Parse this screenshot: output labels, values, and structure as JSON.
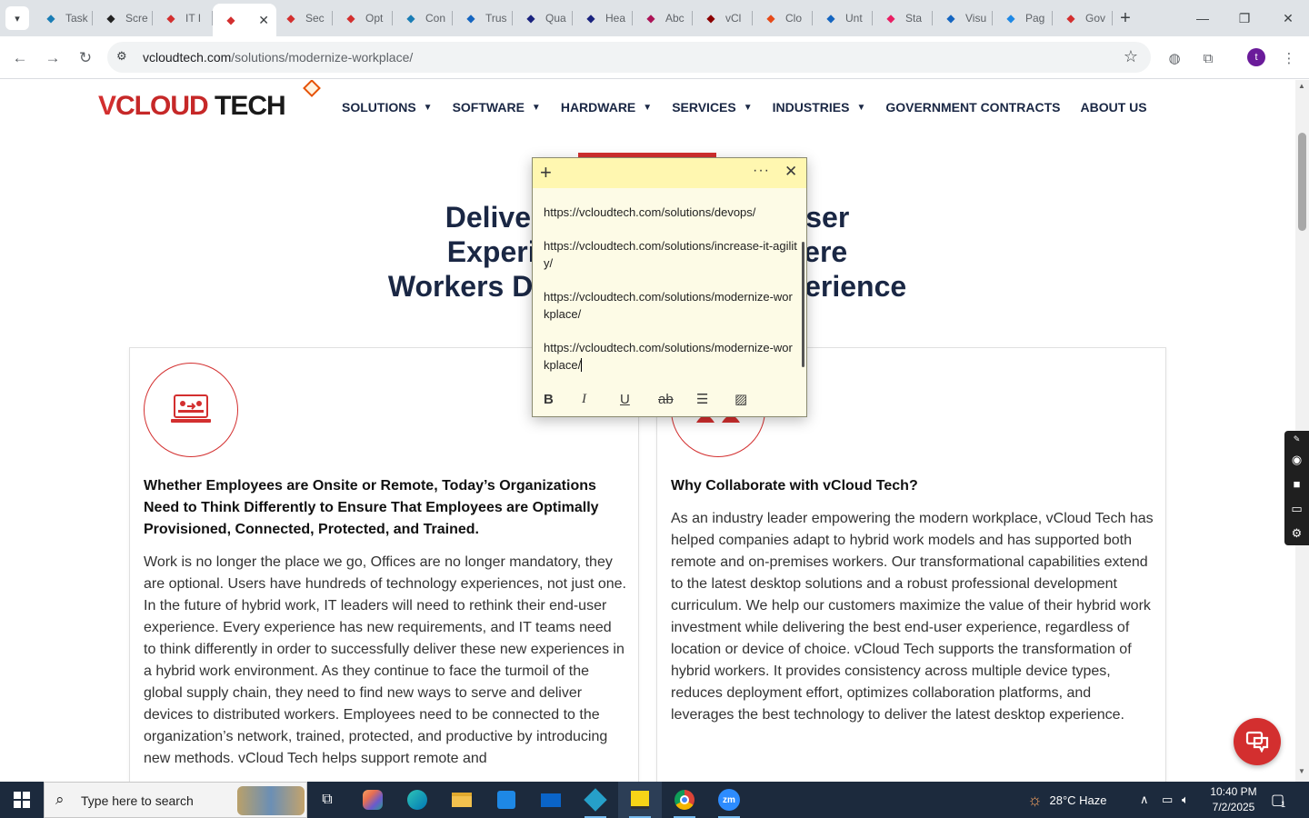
{
  "browser": {
    "tabs": [
      {
        "label": "Task",
        "favicon": "blue-diamond-icon",
        "color": "#1a7db5"
      },
      {
        "label": "Scre",
        "favicon": "gear-icon",
        "color": "#222222"
      },
      {
        "label": "IT I",
        "favicon": "tag-icon",
        "color": "#d32f2f"
      },
      {
        "label": "",
        "favicon": "tag-icon",
        "color": "#d32f2f",
        "active": true
      },
      {
        "label": "Sec",
        "favicon": "tag-icon",
        "color": "#d32f2f"
      },
      {
        "label": "Opt",
        "favicon": "tag-icon",
        "color": "#d32f2f"
      },
      {
        "label": "Con",
        "favicon": "blue-diamond-icon",
        "color": "#1a7db5"
      },
      {
        "label": "Trus",
        "favicon": "scales-icon",
        "color": "#1565c0"
      },
      {
        "label": "Qua",
        "favicon": "x-icon",
        "color": "#1a237e"
      },
      {
        "label": "Hea",
        "favicon": "check-icon",
        "color": "#1a237e"
      },
      {
        "label": "Abc",
        "favicon": "swirl-icon",
        "color": "#ad1457"
      },
      {
        "label": "vCl",
        "favicon": "v-icon",
        "color": "#8b0000"
      },
      {
        "label": "Clo",
        "favicon": "slash-icon",
        "color": "#e64a19"
      },
      {
        "label": "Unt",
        "favicon": "doc-icon",
        "color": "#1565c0"
      },
      {
        "label": "Sta",
        "favicon": "pin-icon",
        "color": "#e91e63"
      },
      {
        "label": "Visu",
        "favicon": "pulse-icon",
        "color": "#1565c0"
      },
      {
        "label": "Pag",
        "favicon": "gauge-icon",
        "color": "#1e88e5"
      },
      {
        "label": "Gov",
        "favicon": "tag-icon",
        "color": "#d32f2f"
      }
    ],
    "new_tab": "+",
    "address": {
      "domain": "vcloudtech.com",
      "path": "/solutions/modernize-workplace/"
    },
    "profile_initial": "t"
  },
  "site": {
    "logo": {
      "v": "V",
      "cloud": "CLOUD",
      "tech": " TECH"
    },
    "nav": [
      {
        "label": "SOLUTIONS",
        "dropdown": true
      },
      {
        "label": "SOFTWARE",
        "dropdown": true
      },
      {
        "label": "HARDWARE",
        "dropdown": true
      },
      {
        "label": "SERVICES",
        "dropdown": true
      },
      {
        "label": "INDUSTRIES",
        "dropdown": true
      },
      {
        "label": "GOVERNMENT CONTRACTS",
        "dropdown": false
      },
      {
        "label": "ABOUT US",
        "dropdown": false
      }
    ],
    "hero_lines": [
      "Delivering an Optimized User",
      "Experience in a World Where",
      "Workers Demand a Better Experience"
    ],
    "left_card": {
      "heading": "Whether Employees are Onsite or Remote, Today’s Organizations Need to Think Differently to Ensure That Employees are Optimally Provisioned, Connected, Protected, and Trained.",
      "body": "Work is no longer the place we go, Offices are no longer mandatory, they are optional. Users have hundreds of technology experiences, not just one.  In the future of hybrid work, IT leaders will need to rethink their end-user experience. Every experience has new requirements, and IT teams need to think differently in order to successfully deliver these new experiences in a hybrid work environment. As they continue to face the turmoil of the global supply chain, they need to find new ways to serve and deliver devices to distributed workers. Employees need to be connected to the organization’s network, trained, protected, and productive by introducing new methods. vCloud Tech helps support remote and"
    },
    "right_card": {
      "heading": "Why Collaborate with vCloud Tech?",
      "body": "As an industry leader empowering the modern workplace, vCloud Tech has helped companies adapt to hybrid work models and has supported both remote and on-premises workers. Our transformational capabilities extend to the latest desktop solutions and a robust professional development curriculum. We help our customers maximize the value of their hybrid work investment while delivering the best end-user experience, regardless of location or device of choice. vCloud Tech supports the transformation of hybrid workers. It provides consistency across multiple device types, reduces deployment effort, optimizes collaboration platforms, and leverages the best technology to deliver the latest desktop experience."
    }
  },
  "sticky_note": {
    "lines": [
      "https://vcloudtech.com/solutions/devops/",
      "https://vcloudtech.com/solutions/increase-it-agility/",
      "https://vcloudtech.com/solutions/modernize-workplace/",
      "https://vcloudtech.com/solutions/modernize-workplace/"
    ],
    "toolbar": [
      "B",
      "I",
      "U",
      "ab",
      "list",
      "image"
    ]
  },
  "taskbar": {
    "search_placeholder": "Type here to search",
    "weather": "28°C  Haze",
    "time": "10:40 PM",
    "date": "7/2/2025",
    "notification_count": "1"
  },
  "colors": {
    "brand_red": "#d32f2f",
    "navy": "#1a2744",
    "sticky_yellow": "#fff7b0"
  }
}
